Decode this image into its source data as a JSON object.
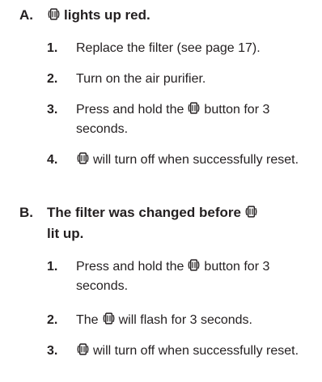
{
  "sections": [
    {
      "letter": "A.",
      "heading_text": "lights up red.",
      "steps": [
        {
          "num": "1.",
          "text": "Replace the filter (see page 17)."
        },
        {
          "num": "2.",
          "text": "Turn on the air purifier."
        },
        {
          "num": "3.",
          "pre": "Press and hold the",
          "post": "button for 3 seconds."
        },
        {
          "num": "4.",
          "post": "will turn off when successfully reset."
        }
      ]
    },
    {
      "letter": "B.",
      "heading_pre": "The filter was changed before",
      "heading_post": "lit up.",
      "steps": [
        {
          "num": "1.",
          "pre": "Press and hold the",
          "post": "button for 3 seconds."
        },
        {
          "num": "2.",
          "pre": "The",
          "post": "will flash for 3 seconds."
        },
        {
          "num": "3.",
          "post": "will turn off when successfully reset."
        }
      ]
    }
  ],
  "icon": "filter-reset-icon"
}
